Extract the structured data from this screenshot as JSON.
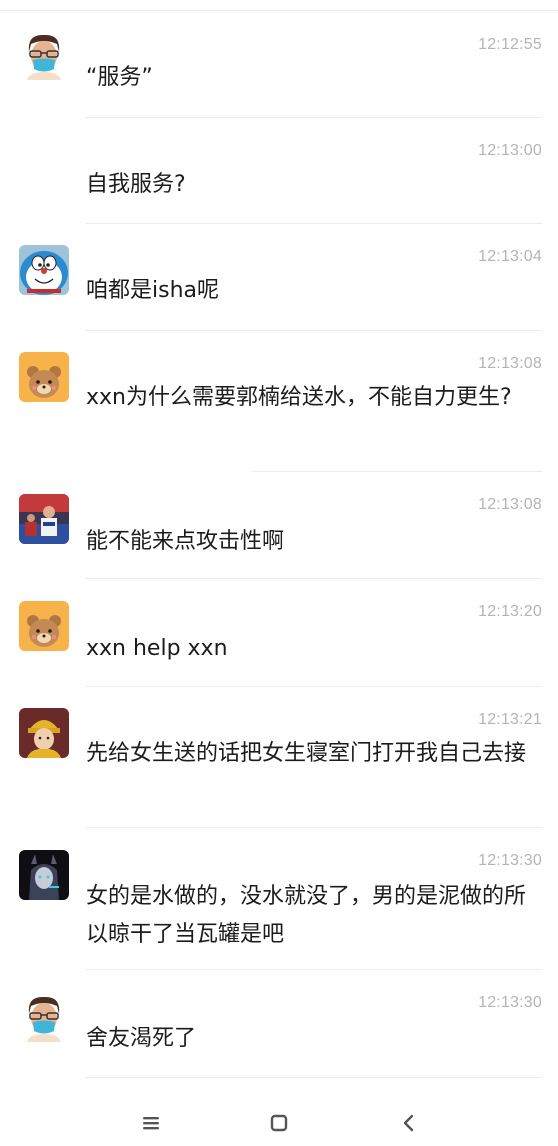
{
  "messages": [
    {
      "avatar": "cartoon-man-with-mask",
      "time": "12:12:55",
      "text": "“服务”"
    },
    {
      "avatar": "blank",
      "time": "12:13:00",
      "text": "自我服务?"
    },
    {
      "avatar": "doraemon",
      "time": "12:13:04",
      "text": "咱都是isha呢"
    },
    {
      "avatar": "orange-bear",
      "time": "12:13:08",
      "text": "xxn为什么需要郭楠给送水，不能自力更生?"
    },
    {
      "avatar": "sports-photo",
      "time": "12:13:08",
      "text": "能不能来点攻击性啊"
    },
    {
      "avatar": "orange-bear",
      "time": "12:13:20",
      "text": "xxn  help xxn"
    },
    {
      "avatar": "girl-yellow-hat",
      "time": "12:13:21",
      "text": "先给女生送的话把女生寝室门打开我自己去接"
    },
    {
      "avatar": "dark-anime-character",
      "time": "12:13:30",
      "text": "女的是水做的，没水就没了，男的是泥做的所以晾干了当瓦罐是吧"
    },
    {
      "avatar": "cartoon-man-with-mask",
      "time": "12:13:30",
      "text": "舍友渴死了"
    }
  ],
  "navbar": {
    "icons": [
      "menu-icon",
      "home-icon",
      "back-icon"
    ]
  },
  "colors": {
    "timestamp": "#b4b4b4",
    "divider": "#ececec",
    "text": "#1c1c1c",
    "bear_bg": "#f7b24a"
  }
}
